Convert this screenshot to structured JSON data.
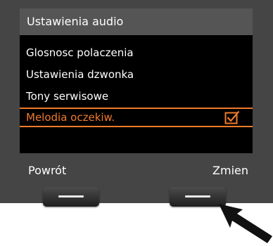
{
  "screen": {
    "title": "Ustawienia audio",
    "menu_items": [
      {
        "label": "Glosnosc polaczenia",
        "selected": false
      },
      {
        "label": "Ustawienia dzwonka",
        "selected": false
      },
      {
        "label": "Tony serwisowe",
        "selected": false
      },
      {
        "label": "Melodia oczekiw.",
        "selected": true,
        "checked": true
      }
    ],
    "softkeys": {
      "left": "Powrót",
      "right": "Zmien"
    }
  },
  "colors": {
    "highlight": "#f07a2a",
    "screen_bg": "#000000",
    "title_bg": "#555555",
    "device_bg": "#454545"
  },
  "icons": {
    "checkbox": "checkbox-checked-icon",
    "pointer": "pointer-arrow-icon"
  }
}
